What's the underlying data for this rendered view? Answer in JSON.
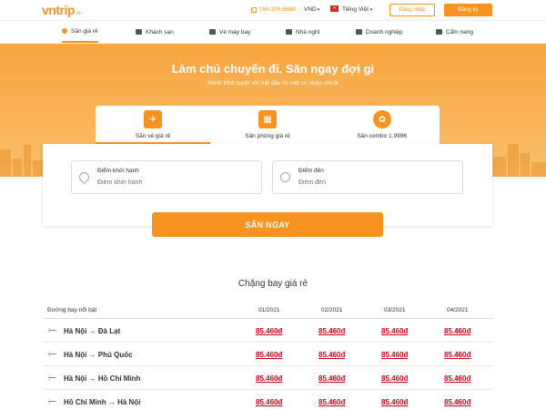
{
  "header": {
    "logo_text": "vntrip",
    "logo_suffix": ".vn",
    "phone": "096.326.6688",
    "currency": "VND",
    "language": "Tiếng Việt",
    "login_label": "Đăng nhập",
    "register_label": "Đăng ký"
  },
  "nav": [
    {
      "label": "Săn giá rẻ",
      "active": true
    },
    {
      "label": "Khách sạn"
    },
    {
      "label": "Vé máy bay"
    },
    {
      "label": "Nhà nghỉ"
    },
    {
      "label": "Doanh nghiệp"
    },
    {
      "label": "Cẩm nang"
    }
  ],
  "hero": {
    "title": "Làm chủ chuyến đi. Săn ngay đợi gì",
    "subtitle": "Hành trình tuyệt vời bắt đầu từ một cú nhấp chuột"
  },
  "tabs": [
    {
      "label": "Săn vé giá rẻ",
      "icon": "plane-icon",
      "active": true
    },
    {
      "label": "Săn phòng giá rẻ",
      "icon": "building-icon"
    },
    {
      "label": "Săn combo 1.999K",
      "icon": "combo-icon"
    }
  ],
  "search": {
    "from_label": "Điểm khởi hành",
    "from_placeholder": "Điểm khởi hành",
    "to_label": "Điểm đến",
    "to_placeholder": "Điểm đến",
    "submit_label": "SĂN NGAY"
  },
  "flights": {
    "title": "Chặng bay giá rẻ",
    "route_header": "Đường bay nổi bật",
    "months": [
      "01/2021",
      "02/2021",
      "03/2021",
      "04/2021"
    ],
    "rows": [
      {
        "route": "Hà Nội → Đà Lạt",
        "prices": [
          "85.460đ",
          "85.460đ",
          "85.460đ",
          "85.460đ"
        ]
      },
      {
        "route": "Hà Nội → Phú Quốc",
        "prices": [
          "85.460đ",
          "85.460đ",
          "85.460đ",
          "85.460đ"
        ]
      },
      {
        "route": "Hà Nội → Hồ Chí Minh",
        "prices": [
          "85.460đ",
          "85.460đ",
          "85.460đ",
          "85.460đ"
        ]
      },
      {
        "route": "Hồ Chí Minh → Hà Nội",
        "prices": [
          "85.460đ",
          "85.460đ",
          "85.460đ",
          "85.460đ"
        ]
      }
    ]
  },
  "colors": {
    "accent": "#f7931e",
    "price": "#d0021b"
  }
}
